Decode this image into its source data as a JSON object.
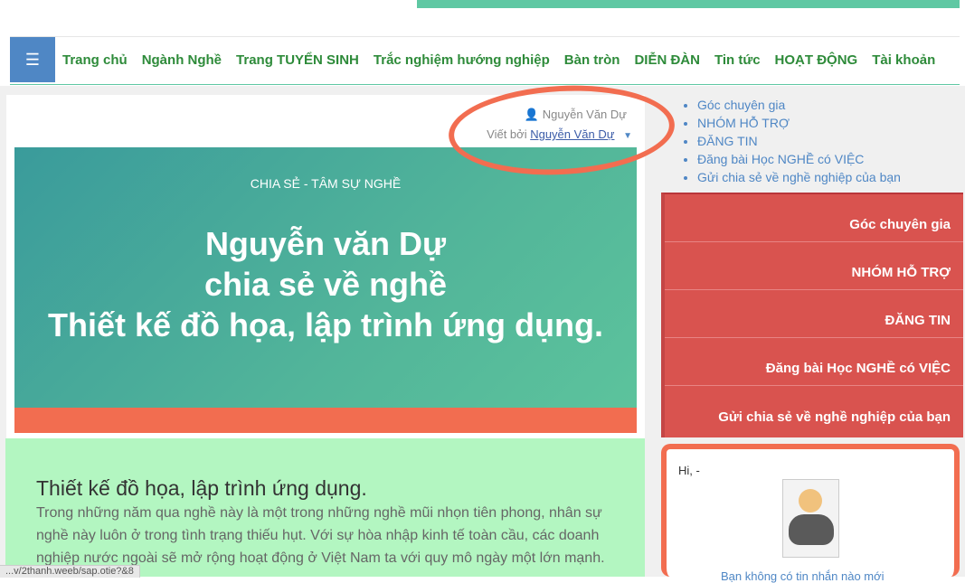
{
  "nav": {
    "menu_icon": "hamburger-icon",
    "items": [
      "Trang chủ",
      "Ngành Nghề",
      "Trang TUYỂN SINH",
      "Trắc nghiệm hướng nghiệp",
      "Bàn tròn",
      "DIỄN ĐÀN",
      "Tin tức",
      "HOẠT ĐỘNG",
      "Tài khoản"
    ]
  },
  "article": {
    "author_name": "Nguyễn Văn Dự",
    "byline_prefix": "Viết bởi",
    "byline_author": "Nguyễn Văn Dự",
    "hero_kicker": "CHIA SẺ - TÂM SỰ NGHỀ",
    "hero_line1": "Nguyễn văn Dự",
    "hero_line2": "chia sẻ về nghề",
    "hero_line3": "Thiết kế đồ họa, lập trình ứng dụng.",
    "section_title": "Thiết kế đồ họa, lập trình ứng dụng.",
    "body_text": "Trong những năm qua nghề này là một trong những nghề mũi nhọn tiên phong, nhân sự nghề này luôn ở trong tình trạng thiếu hụt. Với sự hòa nhập kinh tế toàn cầu, các doanh nghiệp nước ngoài sẽ mở rộng hoạt động ở Việt Nam ta với quy mô ngày một lớn mạnh."
  },
  "sidebar": {
    "links": [
      "Góc chuyên gia",
      "NHÓM HỖ TRỢ",
      "ĐĂNG TIN",
      "Đăng bài Học NGHỀ có VIỆC",
      "Gửi chia sẻ về nghề nghiệp của bạn"
    ],
    "red_items": [
      "Góc chuyên gia",
      "NHÓM HỖ TRỢ",
      "ĐĂNG TIN",
      "Đăng bài Học NGHỀ có VIỆC",
      "Gửi chia sẻ về nghề nghiệp của bạn"
    ]
  },
  "user_box": {
    "greeting": "Hi, -",
    "no_messages": "Bạn không có tin nhắn nào mới"
  },
  "status_bar": {
    "url": "...v/2thanh.weeb/sap.otie?&8"
  },
  "colors": {
    "brand_green": "#2e8b3a",
    "accent_blue": "#4f87c5",
    "hero_orange": "#f26d50",
    "red_panel": "#d9534f",
    "mint_panel": "#b3f6c1"
  }
}
